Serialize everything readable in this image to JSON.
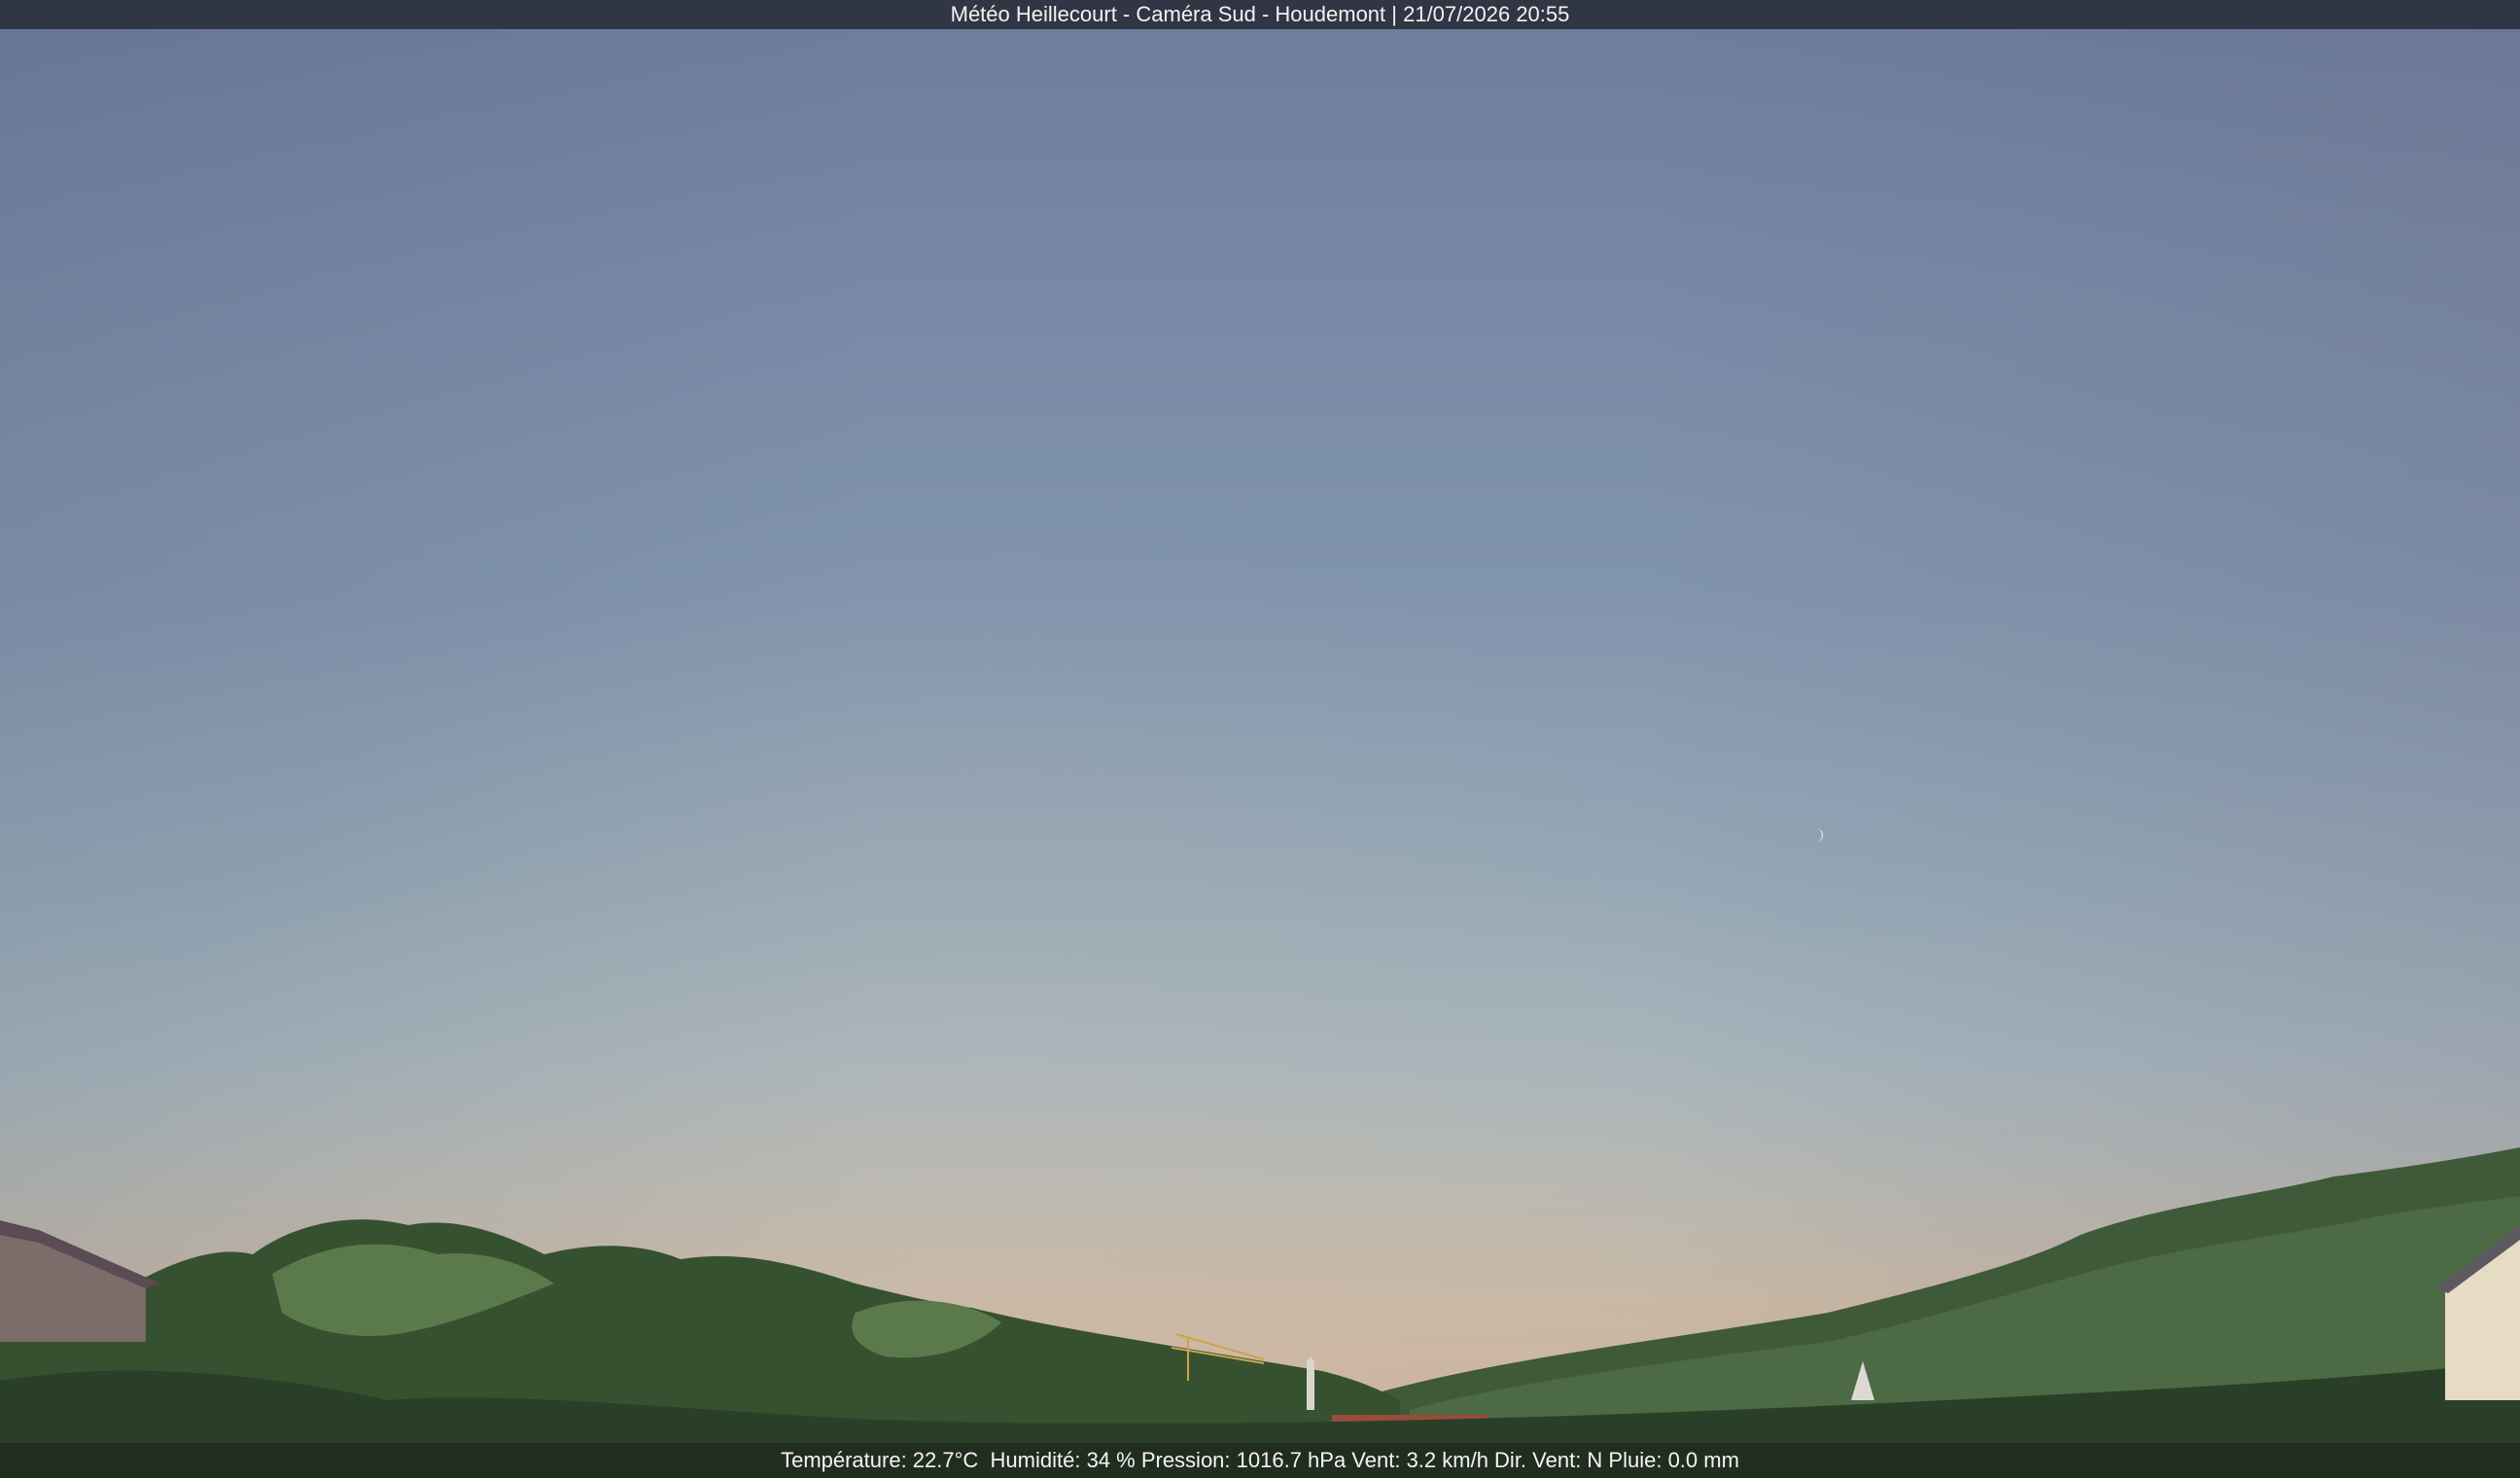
{
  "overlay": {
    "title": "Météo Heillecourt - Caméra Sud - Houdemont | 21/07/2026 20:55",
    "status": "Température: 22.7°C  Humidité: 34 % Pression: 1016.7 hPa Vent: 3.2 km/h Dir. Vent: N Pluie: 0.0 mm"
  },
  "scene": {
    "sky_top": "#6c7c9c",
    "sky_horizon": "#cfb39c",
    "foliage_dark": "#2f4a2c",
    "foliage_light": "#5e7d4e",
    "roof": "#9a4b3c",
    "moon": "#e9ecef",
    "icons": [
      "moon-icon",
      "crane-icon",
      "church-spire-icon"
    ]
  }
}
